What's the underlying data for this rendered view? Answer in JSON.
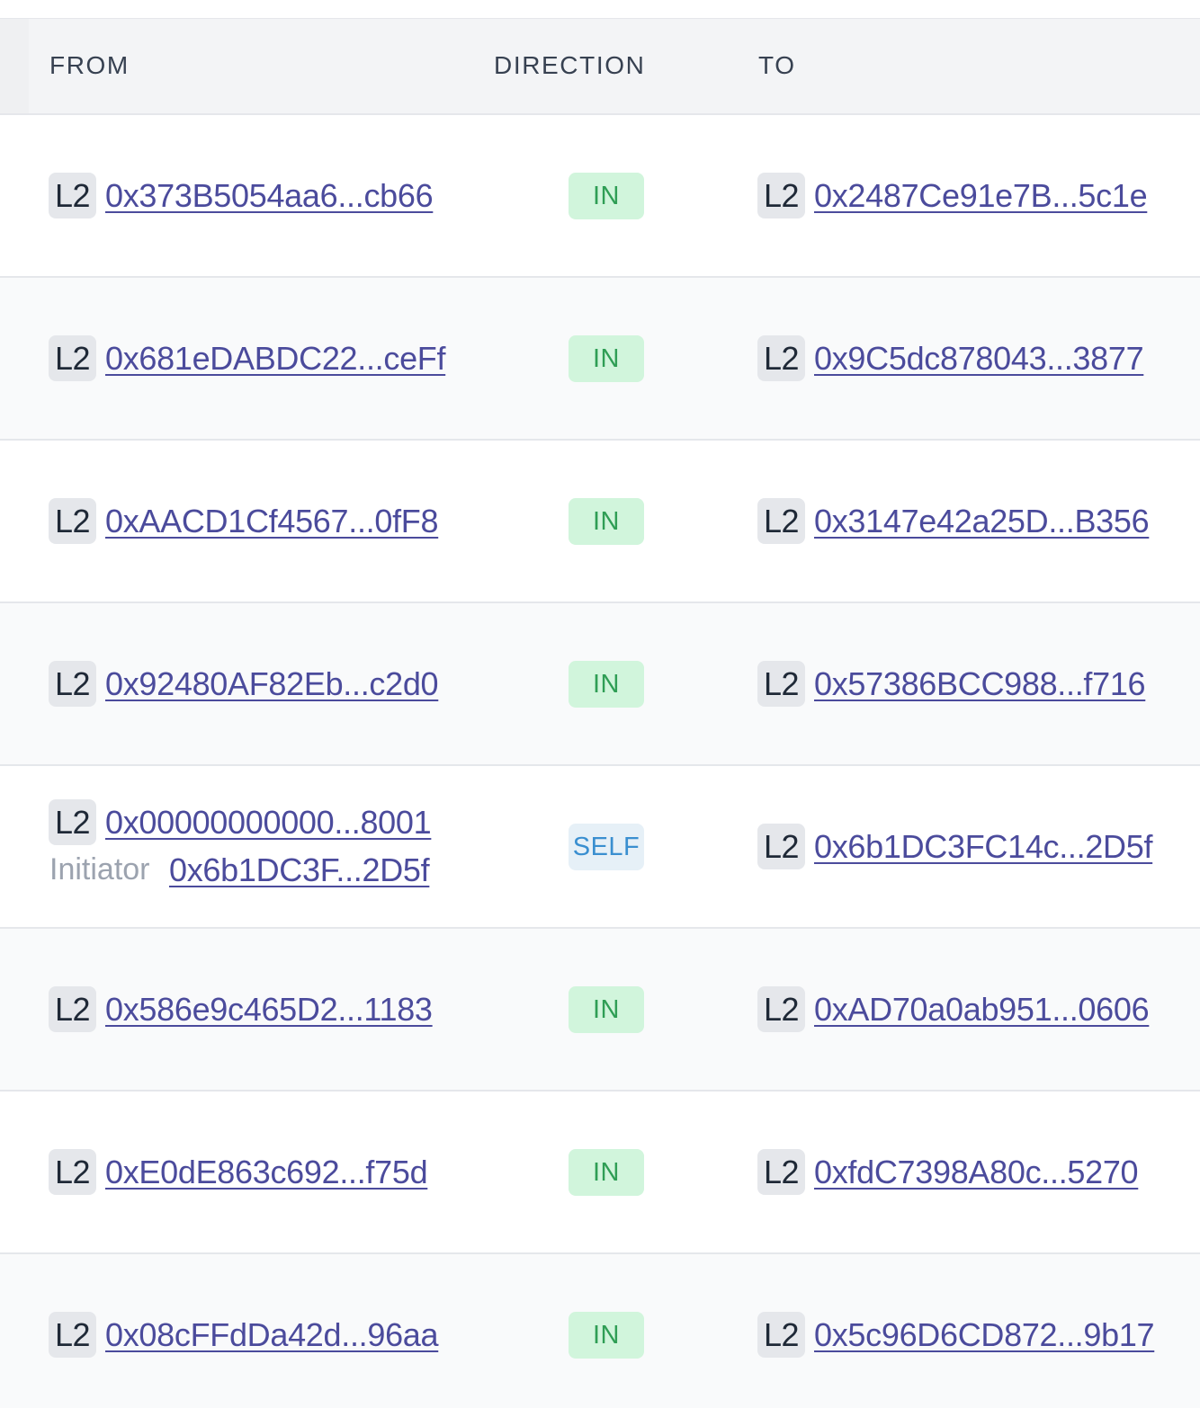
{
  "header": {
    "from_label": "FROM",
    "direction_label": "DIRECTION",
    "to_label": "TO"
  },
  "rows": [
    {
      "from_chip": "L2",
      "from_address": "0x373B5054aa6...cb66",
      "direction": "IN",
      "to_chip": "L2",
      "to_address": "0x2487Ce91e7B...5c1e"
    },
    {
      "from_chip": "L2",
      "from_address": "0x681eDABDC22...ceFf",
      "direction": "IN",
      "to_chip": "L2",
      "to_address": "0x9C5dc878043...3877"
    },
    {
      "from_chip": "L2",
      "from_address": "0xAACD1Cf4567...0fF8",
      "direction": "IN",
      "to_chip": "L2",
      "to_address": "0x3147e42a25D...B356"
    },
    {
      "from_chip": "L2",
      "from_address": "0x92480AF82Eb...c2d0",
      "direction": "IN",
      "to_chip": "L2",
      "to_address": "0x57386BCC988...f716"
    },
    {
      "from_chip": "L2",
      "from_address": "0x00000000000...8001",
      "initiator_label": "Initiator",
      "initiator_address": "0x6b1DC3F...2D5f",
      "direction": "SELF",
      "to_chip": "L2",
      "to_address": "0x6b1DC3FC14c...2D5f"
    },
    {
      "from_chip": "L2",
      "from_address": "0x586e9c465D2...1183",
      "direction": "IN",
      "to_chip": "L2",
      "to_address": "0xAD70a0ab951...0606"
    },
    {
      "from_chip": "L2",
      "from_address": "0xE0dE863c692...f75d",
      "direction": "IN",
      "to_chip": "L2",
      "to_address": "0xfdC7398A80c...5270"
    },
    {
      "from_chip": "L2",
      "from_address": "0x08cFFdDa42d...96aa",
      "direction": "IN",
      "to_chip": "L2",
      "to_address": "0x5c96D6CD872...9b17"
    }
  ],
  "colors": {
    "link": "#4b4b9c",
    "badge_in_bg": "#d1f5dc",
    "badge_in_text": "#2f9e55",
    "badge_self_bg": "#e6f0f7",
    "badge_self_text": "#3a8fd0",
    "chip_bg": "#e5e7eb",
    "header_bg": "#f3f4f6"
  }
}
